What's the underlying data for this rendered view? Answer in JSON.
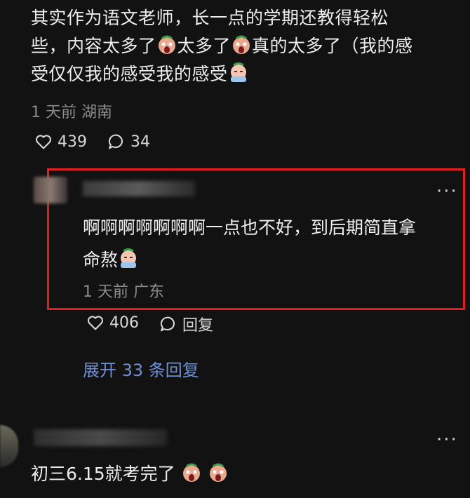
{
  "comment1": {
    "line1": "其实作为语文老师，长一点的学期还教得轻松",
    "line2a": "些，内容太多了",
    "line2b": "太多了",
    "line2c": "真的太多了（我的感",
    "line3": "受仅仅我的感受我的感受",
    "meta": "1 天前 湖南",
    "likes": "439",
    "comments": "34"
  },
  "reply": {
    "line1": "啊啊啊啊啊啊啊一点也不好，到后期简直拿",
    "line2": "命熬",
    "meta": "1 天前 广东",
    "likes": "406",
    "reply_label": "回复",
    "more": "···"
  },
  "expand_label": "展开 33 条回复",
  "comment3": {
    "text": "初三6.15就考完了",
    "more": "···"
  },
  "colors": {
    "highlight_border": "#e02020",
    "link": "#6f8fd4",
    "emoji_scream": "#e8a08a",
    "emoji_cry": "#8ab8e8"
  },
  "icons": [
    "heart-icon",
    "comment-bubble-icon",
    "scream-emoji",
    "crying-emoji",
    "more-icon"
  ]
}
